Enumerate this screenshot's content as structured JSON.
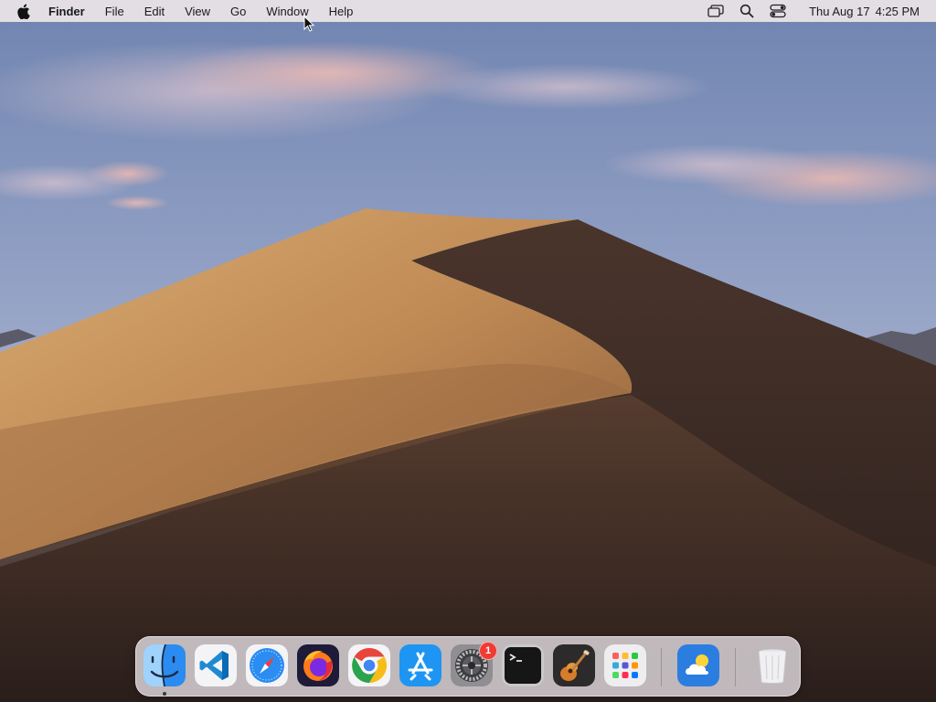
{
  "menubar": {
    "app_name": "Finder",
    "menus": [
      "File",
      "Edit",
      "View",
      "Go",
      "Window",
      "Help"
    ],
    "status_icons": [
      "screen-mirroring-icon",
      "spotlight-search-icon",
      "control-center-icon"
    ],
    "date": "Thu Aug 17",
    "time": "4:25 PM"
  },
  "dock": {
    "apps": [
      {
        "name": "Finder",
        "icon": "finder-icon",
        "running": true
      },
      {
        "name": "Visual Studio Code",
        "icon": "vscode-icon",
        "running": false
      },
      {
        "name": "Safari",
        "icon": "safari-icon",
        "running": false
      },
      {
        "name": "Firefox",
        "icon": "firefox-icon",
        "running": false
      },
      {
        "name": "Google Chrome",
        "icon": "chrome-icon",
        "running": false
      },
      {
        "name": "App Store",
        "icon": "app-store-icon",
        "running": false
      },
      {
        "name": "System Settings",
        "icon": "system-settings-icon",
        "running": false,
        "badge": "1"
      },
      {
        "name": "Terminal",
        "icon": "terminal-icon",
        "running": false
      },
      {
        "name": "GarageBand",
        "icon": "garageband-icon",
        "running": false
      },
      {
        "name": "Launchpad",
        "icon": "launchpad-icon",
        "running": false
      },
      {
        "name": "Weather",
        "icon": "weather-icon",
        "running": false
      },
      {
        "name": "Trash",
        "icon": "trash-icon",
        "running": false
      }
    ]
  },
  "colors": {
    "sky_top": "#7c8fb8",
    "sky_bottom": "#b9c3da",
    "dune_light": "#c99a63",
    "dune_shadow": "#3a2a24",
    "badge": "#ef3b34"
  }
}
